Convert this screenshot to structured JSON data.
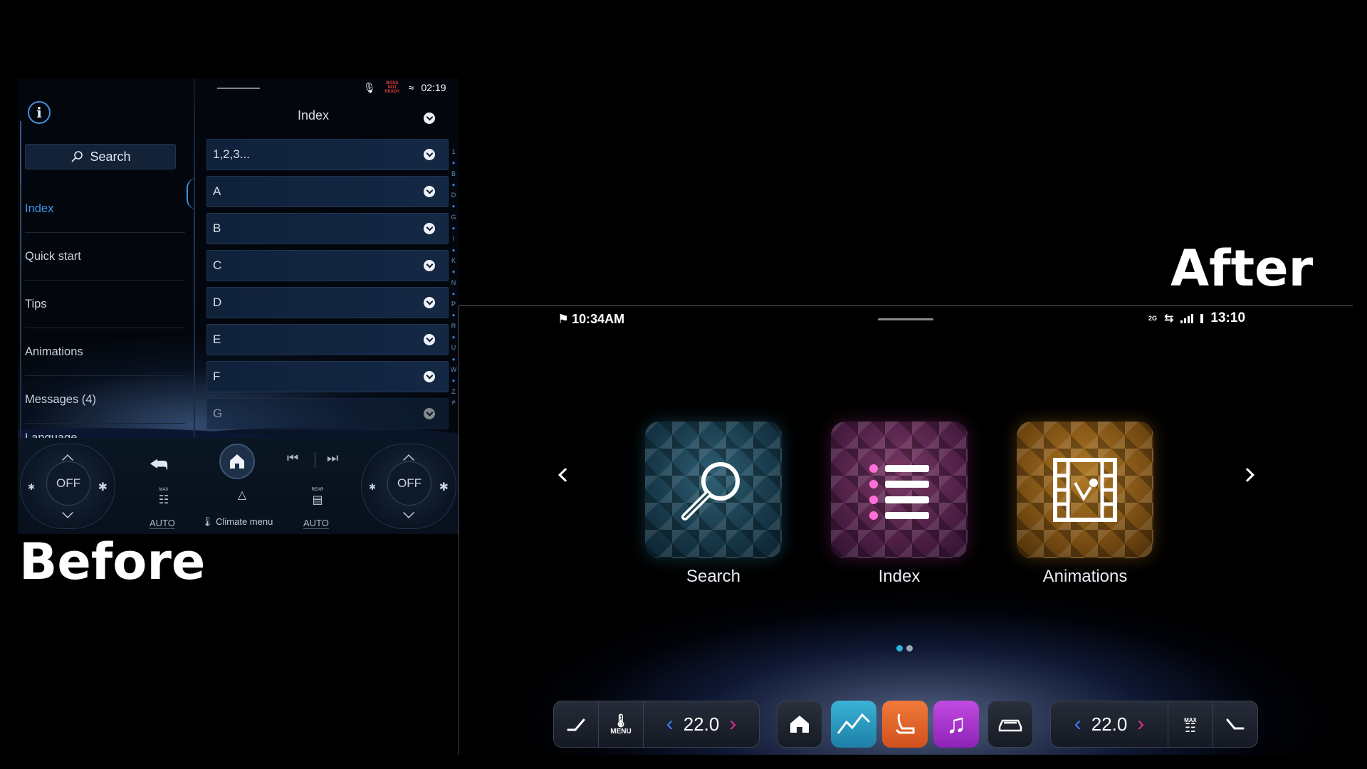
{
  "before": {
    "label": "Before",
    "status": {
      "time": "02:19",
      "warning": "BOSS NOT READY"
    },
    "sidebar": {
      "search_label": "Search",
      "items": [
        {
          "label": "Index",
          "active": true
        },
        {
          "label": "Quick start",
          "active": false
        },
        {
          "label": "Tips",
          "active": false
        },
        {
          "label": "Animations",
          "active": false
        },
        {
          "label": "Messages (4)",
          "active": false
        },
        {
          "label": "Language",
          "active": false
        }
      ]
    },
    "content": {
      "title": "Index",
      "rows": [
        "1,2,3...",
        "A",
        "B",
        "C",
        "D",
        "E",
        "F",
        "G"
      ],
      "alphabet": [
        "1",
        "B",
        "D",
        "G",
        "I",
        "K",
        "N",
        "P",
        "R",
        "U",
        "W",
        "Z",
        "#"
      ]
    },
    "climate": {
      "left_knob": "OFF",
      "right_knob": "OFF",
      "left_auto": "AUTO",
      "right_auto": "AUTO",
      "menu_label": "Climate menu",
      "max_label": "MAX",
      "rear_label": "REAR"
    }
  },
  "after": {
    "label": "After",
    "status": {
      "clock_left": "10:34AM",
      "clock_right": "13:10",
      "net": "2G"
    },
    "tiles": [
      {
        "label": "Search",
        "icon": "magnifier-icon",
        "color": "#1c4556"
      },
      {
        "label": "Index",
        "icon": "list-icon",
        "color": "#5a2450"
      },
      {
        "label": "Animations",
        "icon": "film-strip-icon",
        "color": "#8a5a18"
      }
    ],
    "pager": {
      "pages": 2,
      "current": 1
    },
    "dock": {
      "left_temp": "22.0",
      "right_temp": "22.0",
      "menu_label": "MENU",
      "max_label": "MAX",
      "apps": [
        "home-icon",
        "navigation-icon",
        "seat-icon",
        "music-icon",
        "car-icon"
      ]
    }
  },
  "colors": {
    "accent_blue": "#3f95ec",
    "cyan": "#29b6d8",
    "magenta": "#e0308a"
  }
}
